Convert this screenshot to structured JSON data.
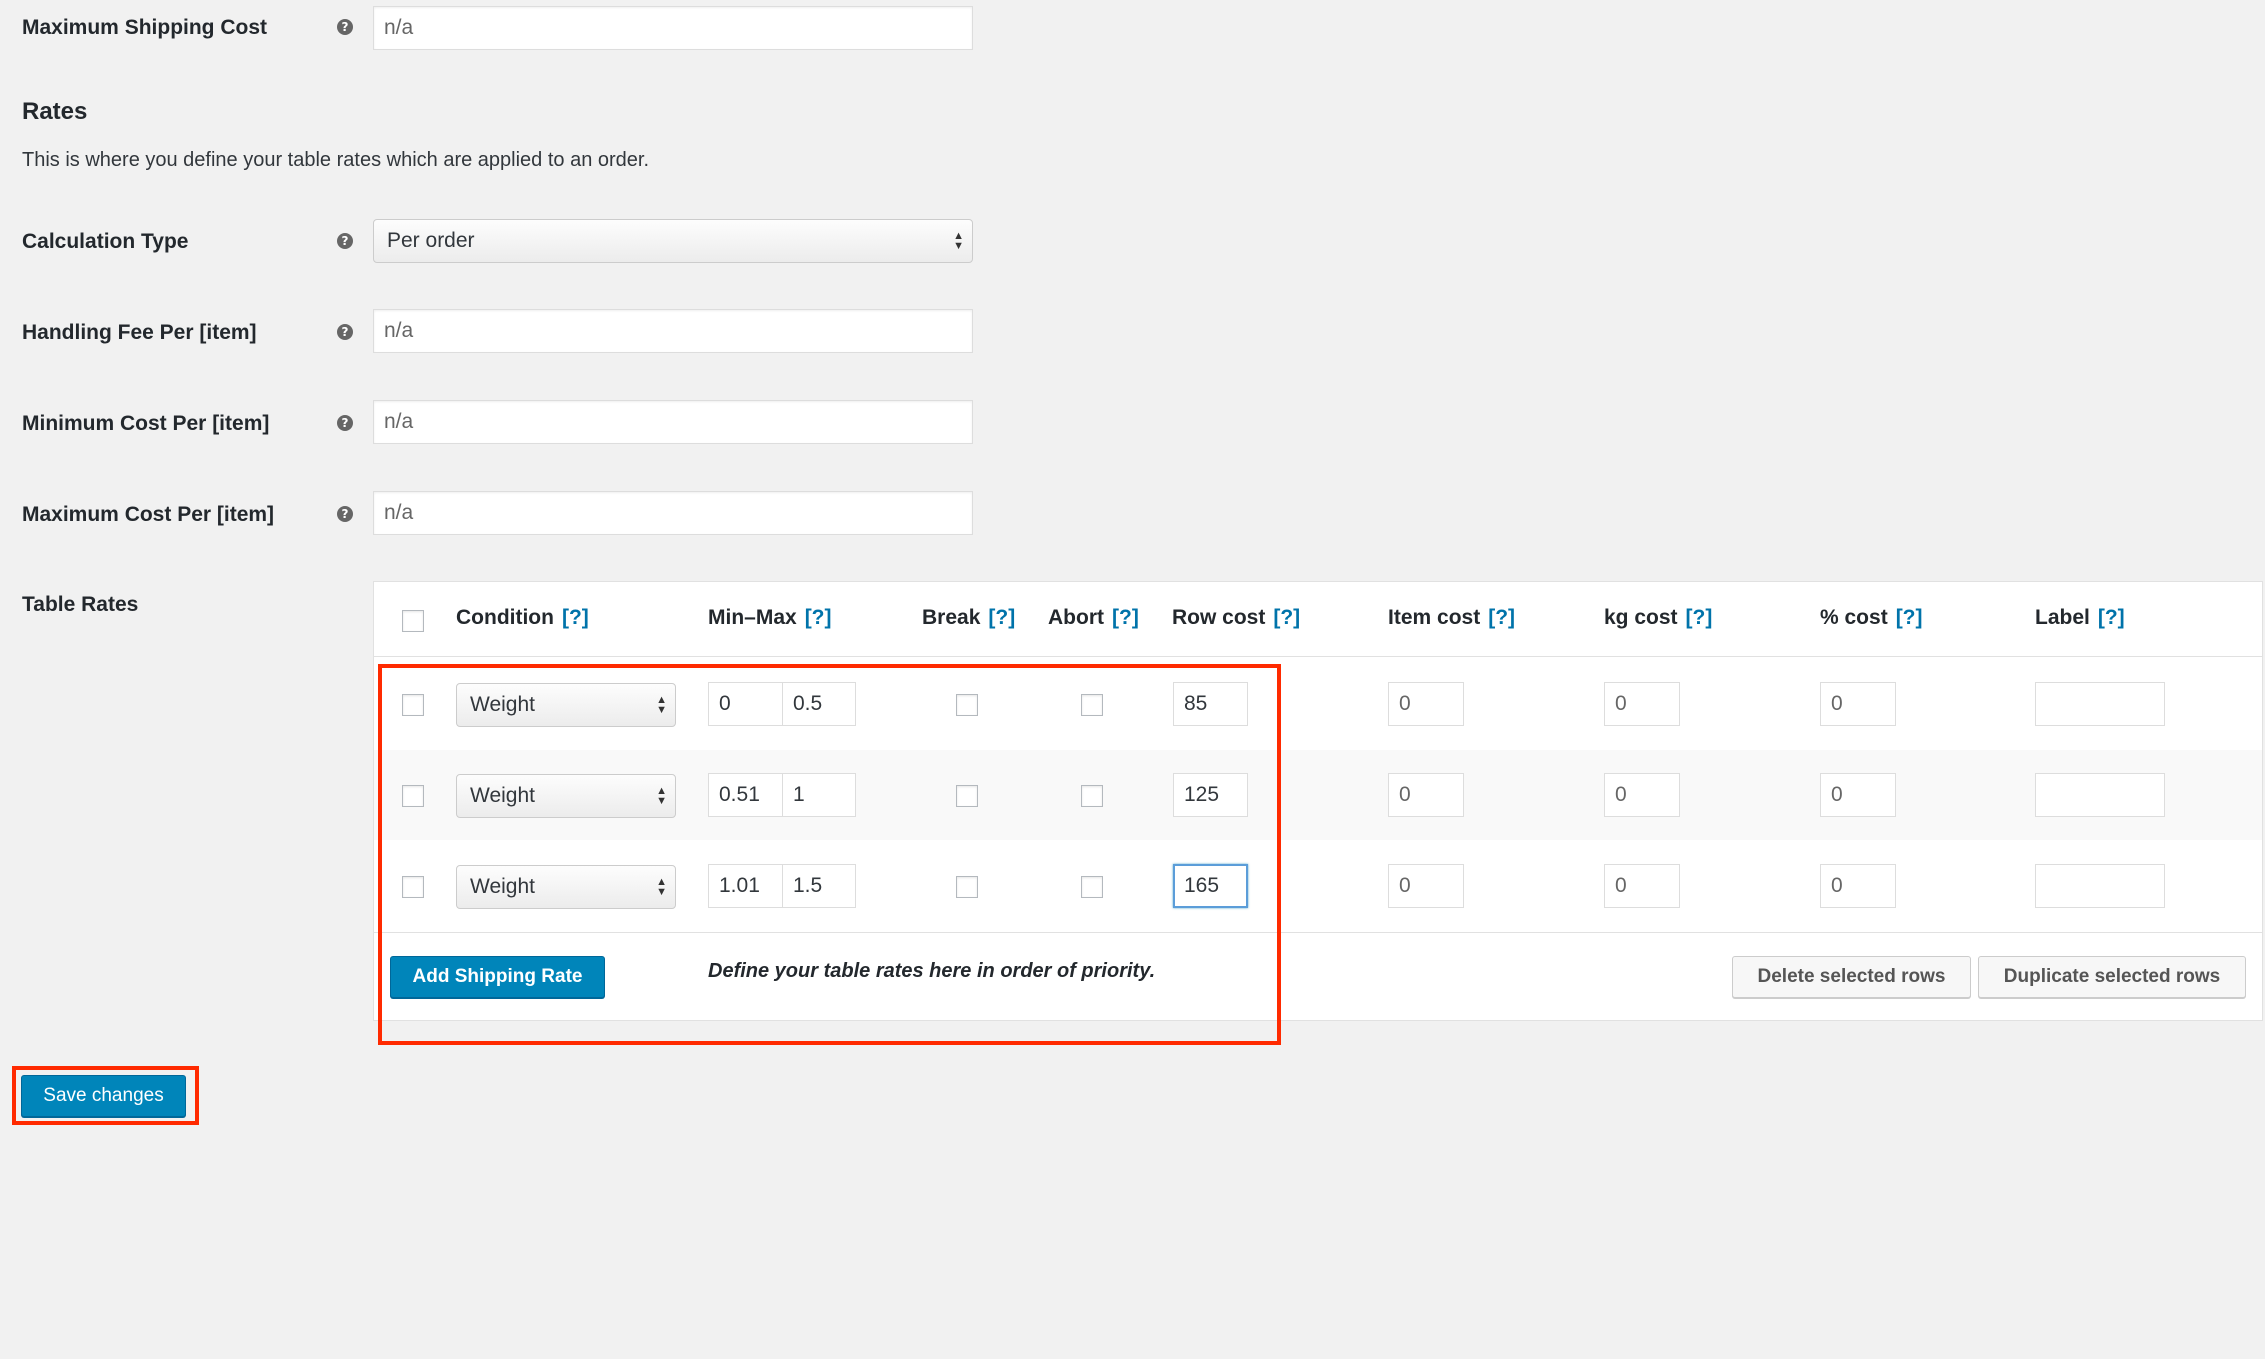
{
  "fields": {
    "max_shipping_cost": {
      "label": "Maximum Shipping Cost",
      "placeholder": "n/a"
    },
    "handling_fee": {
      "label": "Handling Fee Per [item]",
      "placeholder": "n/a"
    },
    "min_cost": {
      "label": "Minimum Cost Per [item]",
      "placeholder": "n/a"
    },
    "max_cost": {
      "label": "Maximum Cost Per [item]",
      "placeholder": "n/a"
    },
    "calculation_type": {
      "label": "Calculation Type",
      "value": "Per order"
    },
    "help_glyph": "?"
  },
  "rates": {
    "heading": "Rates",
    "description": "This is where you define your table rates which are applied to an order."
  },
  "table_rates": {
    "label": "Table Rates",
    "help_link": "[?]",
    "columns": [
      "Condition",
      "Min–Max",
      "Break",
      "Abort",
      "Row cost",
      "Item cost",
      "kg cost",
      "% cost",
      "Label"
    ],
    "rows": [
      {
        "condition": "Weight",
        "min": "0",
        "max": "0.5",
        "row_cost": "85",
        "item_cost": "0",
        "kg_cost": "0",
        "percent_cost": "0",
        "label": ""
      },
      {
        "condition": "Weight",
        "min": "0.51",
        "max": "1",
        "row_cost": "125",
        "item_cost": "0",
        "kg_cost": "0",
        "percent_cost": "0",
        "label": ""
      },
      {
        "condition": "Weight",
        "min": "1.01",
        "max": "1.5",
        "row_cost": "165",
        "item_cost": "0",
        "kg_cost": "0",
        "percent_cost": "0",
        "label": ""
      }
    ],
    "add_button": "Add Shipping Rate",
    "hint": "Define your table rates here in order of priority.",
    "delete_button": "Delete selected rows",
    "duplicate_button": "Duplicate selected rows"
  },
  "save_button": "Save changes",
  "colors": {
    "primary": "#0085ba",
    "highlight": "#ff2a00",
    "background": "#f1f1f1"
  }
}
